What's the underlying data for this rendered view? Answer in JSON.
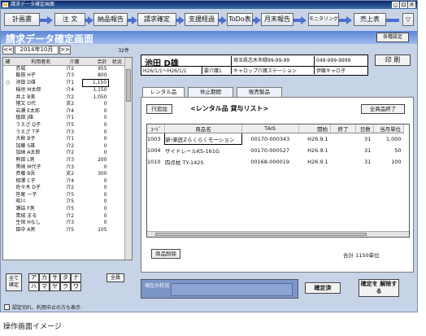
{
  "window": {
    "title": "請求データ確定画面"
  },
  "flow": [
    {
      "label": "計画書"
    },
    {
      "label": "注 文"
    },
    {
      "label": "納品報告"
    },
    {
      "label": "請求確定"
    },
    {
      "label": "支援経過"
    },
    {
      "label": "ToDo表"
    },
    {
      "label": "月末報告"
    },
    {
      "label": "モニタリング"
    },
    {
      "label": "売上表"
    },
    {
      "label": "▽"
    }
  ],
  "header": {
    "title": "請求データ確定画面",
    "settings_label": "各種設定"
  },
  "month_nav": {
    "prev": "<<",
    "month": "2014年10月",
    "next": ">>",
    "count": "32件"
  },
  "client_table": {
    "headers": [
      "確",
      "利用者名",
      "介護",
      "合計",
      "状況"
    ],
    "rows": [
      {
        "mark": "",
        "name": "赤城",
        "care": "介2",
        "total": "955",
        "status": ""
      },
      {
        "mark": "",
        "name": "飯田 H子",
        "care": "介3",
        "total": "800",
        "status": ""
      },
      {
        "mark": "○",
        "name": "池田 D雄",
        "care": "介1",
        "total": "1,150",
        "status": "",
        "selected": true
      },
      {
        "mark": "",
        "name": "稲垣 M太郎",
        "care": "介4",
        "total": "1,150",
        "status": ""
      },
      {
        "mark": "",
        "name": "井上 B美",
        "care": "介2",
        "total": "1,050",
        "status": ""
      },
      {
        "mark": "",
        "name": "猪又 O代",
        "care": "支2",
        "total": "0",
        "status": ""
      },
      {
        "mark": "",
        "name": "岩瀬 E太郎",
        "care": "介4",
        "total": "0",
        "status": ""
      },
      {
        "mark": "",
        "name": "植田 J雄",
        "care": "介1",
        "total": "0",
        "status": ""
      },
      {
        "mark": "",
        "name": "うえざ Q子",
        "care": "介5",
        "total": "0",
        "status": ""
      },
      {
        "mark": "",
        "name": "うえざ T子",
        "care": "介3",
        "total": "0",
        "status": ""
      },
      {
        "mark": "",
        "name": "大柳 B子",
        "care": "介1",
        "total": "0",
        "status": ""
      },
      {
        "mark": "",
        "name": "加藤 S雄",
        "care": "介2",
        "total": "0",
        "status": ""
      },
      {
        "mark": "",
        "name": "加納 A太郎",
        "care": "介2",
        "total": "0",
        "status": ""
      },
      {
        "mark": "",
        "name": "熊田 L男",
        "care": "介3",
        "total": "200",
        "status": ""
      },
      {
        "mark": "",
        "name": "黒崎 M代子",
        "care": "介3",
        "total": "0",
        "status": ""
      },
      {
        "mark": "",
        "name": "斉藤 B吾",
        "care": "支2",
        "total": "300",
        "status": ""
      },
      {
        "mark": "",
        "name": "相澤 C子",
        "care": "介4",
        "total": "0",
        "status": ""
      },
      {
        "mark": "",
        "name": "佐々木 D子",
        "care": "介2",
        "total": "0",
        "status": ""
      },
      {
        "mark": "",
        "name": "笹尾 一子",
        "care": "介5",
        "total": "0",
        "status": ""
      },
      {
        "mark": "",
        "name": "昭川",
        "care": "介5",
        "total": "0",
        "status": ""
      },
      {
        "mark": "",
        "name": "瀬詰 F男",
        "care": "介5",
        "total": "0",
        "status": ""
      },
      {
        "mark": "",
        "name": "青絨 まる",
        "care": "介2",
        "total": "0",
        "status": ""
      },
      {
        "mark": "",
        "name": "生保 Hなし",
        "care": "介3",
        "total": "0",
        "status": ""
      },
      {
        "mark": "",
        "name": "田中 A男",
        "care": "介5",
        "total": "105",
        "status": ""
      }
    ]
  },
  "filter": {
    "show_all": "全て 確定",
    "kana_row1": [
      "ア",
      "カ",
      "サ",
      "タ",
      "ナ"
    ],
    "kana_row2": [
      "ハ",
      "マ",
      "ヤ",
      "ラ",
      "ワ"
    ],
    "all_items": "全員",
    "show_closed": "認定切れ、利用中止の方も表示"
  },
  "client_info": {
    "name": "池田 D雄",
    "period": "H26/1/1～H26/1/1",
    "care_level": "要介護1",
    "address": "埼玉県志木市緑99-99-99",
    "office": "キャロップ介護ステーション",
    "phone": "049-999-9999",
    "manager": "伊藤キャロ子"
  },
  "print_label": "印 刷",
  "tabs": [
    {
      "label": "レンタル品"
    },
    {
      "label": "休止期間"
    },
    {
      "label": "販売製品"
    }
  ],
  "rental": {
    "add_row": "行追加",
    "title": "<レンタル品 貸与リスト>",
    "end_all": "全商品終了",
    "headers": [
      "ｺｰﾄﾞ",
      "商品名",
      "TAIS",
      "開始",
      "終了",
      "日数",
      "当月単位"
    ],
    "rows": [
      {
        "code": "1003",
        "name": "新!楽匠Zらくらくモーション",
        "tais": "00170-000343",
        "start": "H26.9.1",
        "end": "",
        "days": "31",
        "price": "1,000"
      },
      {
        "code": "1004",
        "name": "サイドレールKS-161G",
        "tais": "00170-000527",
        "start": "H26.9.1",
        "end": "",
        "days": "31",
        "price": "50"
      },
      {
        "code": "1010",
        "name": "四点杖 TY-142S",
        "tais": "00168-000019",
        "start": "H26.9.1",
        "end": "",
        "days": "31",
        "price": "100"
      }
    ],
    "delete": "商品削除",
    "total": "合計 1150単位"
  },
  "note": {
    "label": "現在の状況"
  },
  "confirmed_label": "確定済",
  "cancel_confirm_label": "確定を 解除する",
  "caption": "操作画面イメージ"
}
